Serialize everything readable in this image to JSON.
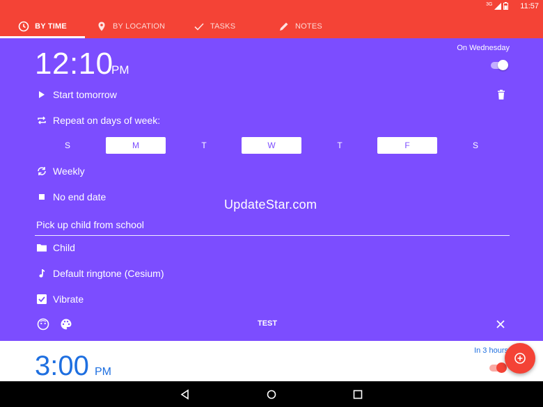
{
  "status_bar": {
    "signal_text": "3G",
    "time": "11:57"
  },
  "tabs": [
    {
      "label": "BY TIME",
      "icon": "clock-icon",
      "active": true
    },
    {
      "label": "BY LOCATION",
      "icon": "location-pin-icon",
      "active": false
    },
    {
      "label": "TASKS",
      "icon": "check-icon",
      "active": false
    },
    {
      "label": "NOTES",
      "icon": "pencil-icon",
      "active": false
    }
  ],
  "alarm": {
    "time": "12:10",
    "ampm": "PM",
    "day_label": "On Wednesday",
    "enabled": true,
    "start_label": "Start tomorrow",
    "repeat_label": "Repeat on days of week:",
    "days": [
      {
        "letter": "S",
        "selected": false
      },
      {
        "letter": "M",
        "selected": true
      },
      {
        "letter": "T",
        "selected": false
      },
      {
        "letter": "W",
        "selected": true
      },
      {
        "letter": "T",
        "selected": false
      },
      {
        "letter": "F",
        "selected": true
      },
      {
        "letter": "S",
        "selected": false
      }
    ],
    "frequency_label": "Weekly",
    "end_label": "No end date",
    "label_value": "Pick up child from school",
    "category_label": "Child",
    "ringtone_label": "Default ringtone (Cesium)",
    "vibrate_label": "Vibrate",
    "vibrate_checked": true,
    "test_label": "TEST"
  },
  "watermark": "UpdateStar.com",
  "next_alarm": {
    "time": "3:00",
    "ampm": "PM",
    "in_label": "In 3 hours",
    "enabled": true
  },
  "colors": {
    "accent": "#f44336",
    "card": "#7c4dff",
    "time_blue": "#1e6fe0"
  }
}
